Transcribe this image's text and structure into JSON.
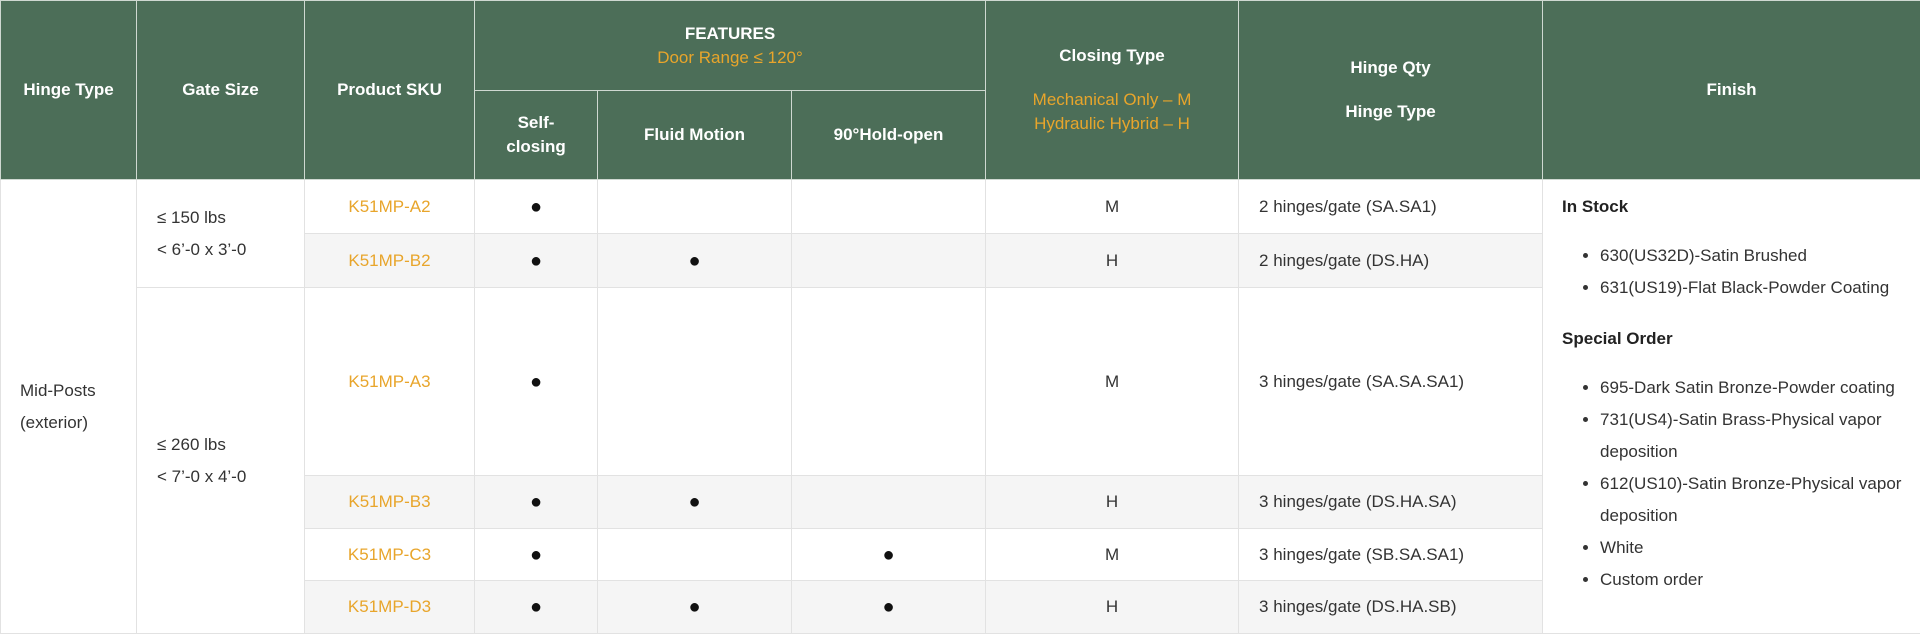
{
  "header": {
    "hinge_type": "Hinge Type",
    "gate_size": "Gate Size",
    "product_sku": "Product SKU",
    "features": "FEATURES",
    "door_range": "Door Range ≤ 120°",
    "self_closing": "Self-\nclosing",
    "fluid_motion": "Fluid Motion",
    "hold_open": "90°Hold-open",
    "closing_type": "Closing Type",
    "closing_m": "Mechanical Only – M",
    "closing_h": "Hydraulic Hybrid – H",
    "hinge_qty": "Hinge Qty",
    "hinge_qty_type": "Hinge Type",
    "finish": "Finish"
  },
  "hinge_type": "Mid-Posts\n(exterior)",
  "gate_sizes": [
    {
      "weight": "≤ 150 lbs",
      "size": "< 6’-0 x 3’-0"
    },
    {
      "weight": "≤ 260 lbs",
      "size": "< 7’-0 x 4’-0"
    }
  ],
  "bullet": "●",
  "rows": [
    {
      "sku": "K51MP-A2",
      "self": "●",
      "fluid": "",
      "hold": "",
      "closing": "M",
      "qty": "2 hinges/gate (SA.SA1)"
    },
    {
      "sku": "K51MP-B2",
      "self": "●",
      "fluid": "●",
      "hold": "",
      "closing": "H",
      "qty": "2 hinges/gate (DS.HA)"
    },
    {
      "sku": "K51MP-A3",
      "self": "●",
      "fluid": "",
      "hold": "",
      "closing": "M",
      "qty": "3 hinges/gate (SA.SA.SA1)"
    },
    {
      "sku": "K51MP-B3",
      "self": "●",
      "fluid": "●",
      "hold": "",
      "closing": "H",
      "qty": "3 hinges/gate (DS.HA.SA)"
    },
    {
      "sku": "K51MP-C3",
      "self": "●",
      "fluid": "",
      "hold": "●",
      "closing": "M",
      "qty": "3 hinges/gate (SB.SA.SA1)"
    },
    {
      "sku": "K51MP-D3",
      "self": "●",
      "fluid": "●",
      "hold": "●",
      "closing": "H",
      "qty": "3 hinges/gate (DS.HA.SB)"
    }
  ],
  "finish": {
    "in_stock_title": "In Stock",
    "in_stock": [
      "630(US32D)-Satin Brushed",
      "631(US19)-Flat Black-Powder Coating"
    ],
    "special_title": "Special Order",
    "special": [
      "695-Dark Satin Bronze-Powder coating",
      "731(US4)-Satin Brass-Physical vapor deposition",
      "612(US10)-Satin Bronze-Physical vapor deposition",
      "White",
      "Custom order"
    ]
  }
}
